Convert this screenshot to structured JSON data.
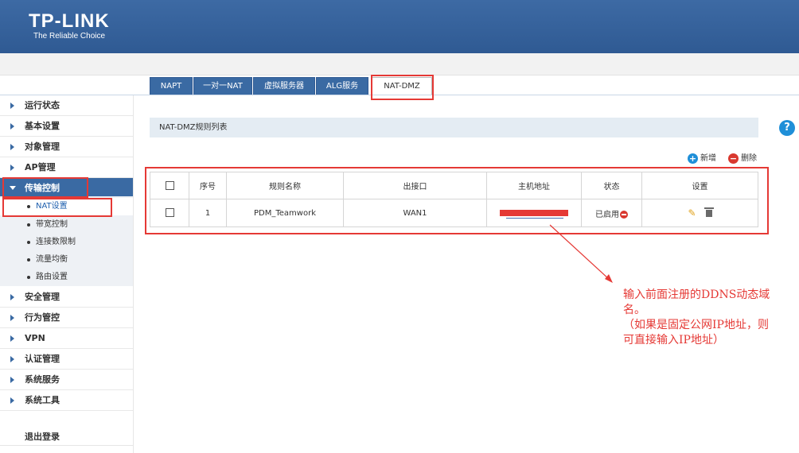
{
  "header": {
    "logo": "TP-LINK",
    "tagline": "The Reliable Choice"
  },
  "tabs": [
    {
      "label": "NAPT"
    },
    {
      "label": "一对一NAT"
    },
    {
      "label": "虚拟服务器"
    },
    {
      "label": "ALG服务"
    },
    {
      "label": "NAT-DMZ",
      "active": true
    }
  ],
  "sidebar": {
    "items": [
      {
        "label": "运行状态"
      },
      {
        "label": "基本设置"
      },
      {
        "label": "对象管理"
      },
      {
        "label": "AP管理"
      },
      {
        "label": "传输控制",
        "expanded": true
      },
      {
        "label": "安全管理"
      },
      {
        "label": "行为管控"
      },
      {
        "label": "VPN"
      },
      {
        "label": "认证管理"
      },
      {
        "label": "系统服务"
      },
      {
        "label": "系统工具"
      }
    ],
    "subitems": [
      {
        "label": "NAT设置",
        "active": true
      },
      {
        "label": "带宽控制"
      },
      {
        "label": "连接数限制"
      },
      {
        "label": "流量均衡"
      },
      {
        "label": "路由设置"
      }
    ],
    "logout": "退出登录"
  },
  "main": {
    "list_title": "NAT-DMZ规则列表",
    "help_icon": "?",
    "add_label": "新增",
    "delete_label": "删除",
    "table": {
      "headers": [
        "序号",
        "规则名称",
        "出接口",
        "主机地址",
        "状态",
        "设置"
      ],
      "rows": [
        {
          "index": "1",
          "name": "PDM_Teamwork",
          "interface": "WAN1",
          "host": "",
          "status": "已启用"
        }
      ]
    }
  },
  "annotation": {
    "line1": "输入前面注册的DDNS动态域",
    "line2": "名。",
    "line3": "（如果是固定公网IP地址，则",
    "line4": "可直接输入IP地址）"
  },
  "colors": {
    "header_bg": "#3d6aa4",
    "accent": "#3a6aa3",
    "highlight": "#e53935",
    "help": "#1f8fd8"
  }
}
